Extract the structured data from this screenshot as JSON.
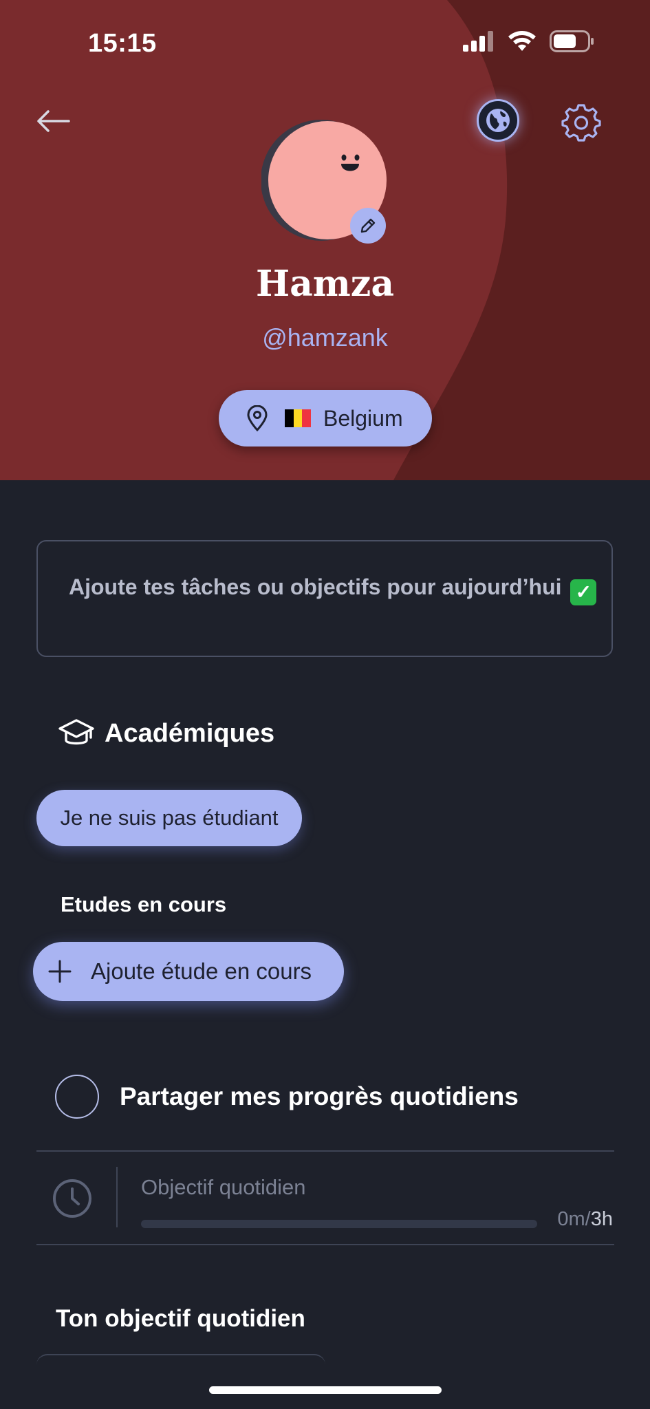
{
  "status_bar": {
    "time": "15:15"
  },
  "header": {
    "back_icon": "arrow-left-icon",
    "globe_icon": "globe-icon",
    "settings_icon": "gear-icon",
    "colors": {
      "hero_light": "#7a2b2d",
      "hero_dark": "#5b1f1f",
      "accent": "#a9b4f2"
    }
  },
  "profile": {
    "name": "Hamza",
    "handle": "@hamzank",
    "avatar_color": "#f8a9a4",
    "edit_icon": "pencil-icon",
    "country": {
      "label": "Belgium",
      "flag_colors": [
        "#000000",
        "#fdda24",
        "#ef3340"
      ],
      "icon": "location-pin-icon"
    }
  },
  "tasks": {
    "placeholder": "Ajoute tes tâches ou objectifs pour aujourd’hui",
    "emoji": "✓"
  },
  "academic": {
    "title": "Académiques",
    "icon": "graduation-cap-icon",
    "not_student_label": "Je ne suis pas étudiant",
    "current_studies_label": "Etudes en cours",
    "add_study_label": "Ajoute étude en cours"
  },
  "share": {
    "label": "Partager mes progrès quotidiens",
    "checked": false
  },
  "daily_goal": {
    "label": "Objectif quotidien",
    "done": "0m",
    "separator": "/",
    "total": "3h",
    "progress": 0
  },
  "your_goal": {
    "title": "Ton objectif quotidien"
  }
}
